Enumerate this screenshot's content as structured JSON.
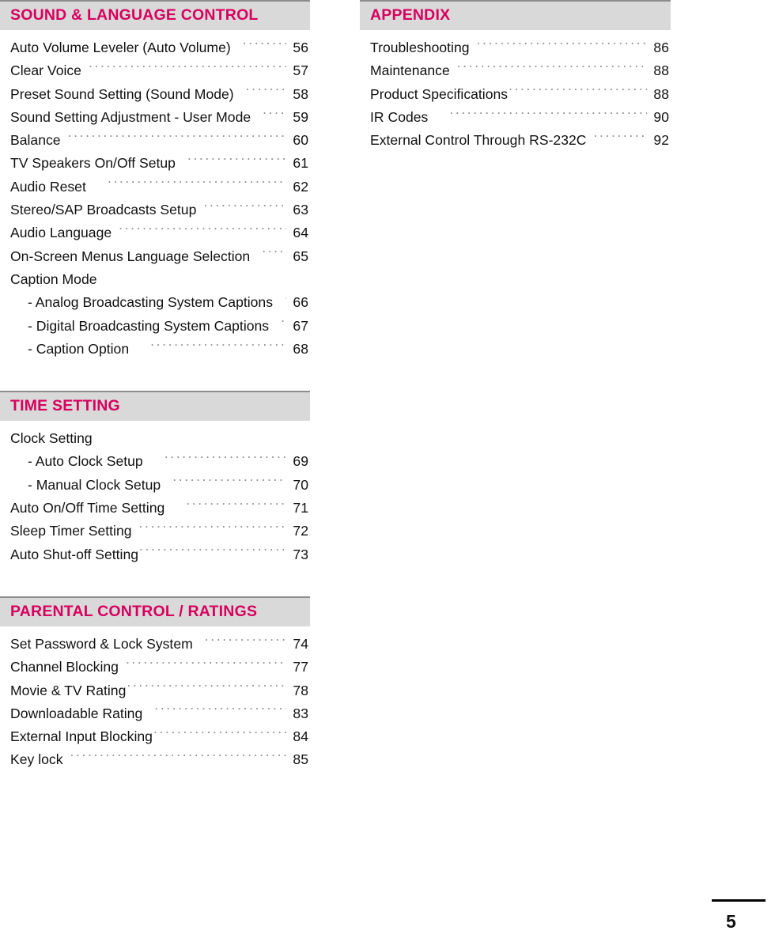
{
  "document": {
    "type": "table-of-contents",
    "page_number": "5"
  },
  "theme": {
    "accent": "#d8005e",
    "header_bar_bg": "#d9d9d9",
    "header_bar_top_rule": "#8d8d8d",
    "text": "#111111",
    "leader_dots": "#8e8e8e",
    "page_bg": "#ffffff"
  },
  "left_column": {
    "sections": [
      {
        "title": "SOUND & LANGUAGE CONTROL",
        "entries": [
          {
            "label": "Auto Volume Leveler (Auto Volume)",
            "page": "56",
            "indent": false,
            "gap": "gap-md"
          },
          {
            "label": "Clear Voice",
            "page": "57",
            "indent": false,
            "gap": "gap-sm"
          },
          {
            "label": "Preset Sound Setting (Sound Mode)",
            "page": "58",
            "indent": false,
            "gap": "gap-md"
          },
          {
            "label": "Sound Setting Adjustment - User Mode",
            "page": "59",
            "indent": false,
            "gap": "gap-md"
          },
          {
            "label": "Balance",
            "page": "60",
            "indent": false,
            "gap": "gap-sm"
          },
          {
            "label": "TV Speakers On/Off Setup",
            "page": "61",
            "indent": false,
            "gap": "gap-md"
          },
          {
            "label": "Audio Reset",
            "page": "62",
            "indent": false,
            "gap": "gap-lg"
          },
          {
            "label": "Stereo/SAP Broadcasts Setup",
            "page": "63",
            "indent": false,
            "gap": "gap-sm"
          },
          {
            "label": "Audio Language",
            "page": "64",
            "indent": false,
            "gap": "gap-sm"
          },
          {
            "label": "On-Screen Menus Language Selection",
            "page": "65",
            "indent": false,
            "gap": "gap-md"
          },
          {
            "label": "Caption Mode",
            "page": "",
            "indent": false,
            "gap": "gap-none",
            "no_leader": true
          },
          {
            "label": "- Analog Broadcasting System Captions",
            "page": "66",
            "indent": true,
            "gap": "gap-md"
          },
          {
            "label": "- Digital Broadcasting System Captions",
            "page": "67",
            "indent": true,
            "gap": "gap-md"
          },
          {
            "label": "- Caption Option",
            "page": "68",
            "indent": true,
            "gap": "gap-lg"
          }
        ]
      },
      {
        "title": "TIME SETTING",
        "entries": [
          {
            "label": "Clock Setting",
            "page": "",
            "indent": false,
            "gap": "gap-none",
            "no_leader": true
          },
          {
            "label": "- Auto Clock Setup",
            "page": "69",
            "indent": true,
            "gap": "gap-lg"
          },
          {
            "label": "- Manual Clock Setup",
            "page": "70",
            "indent": true,
            "gap": "gap-md"
          },
          {
            "label": "Auto On/Off Time Setting",
            "page": "71",
            "indent": false,
            "gap": "gap-lg"
          },
          {
            "label": "Sleep Timer Setting",
            "page": "72",
            "indent": false,
            "gap": "gap-sm"
          },
          {
            "label": "Auto Shut-off Setting",
            "page": "73",
            "indent": false,
            "gap": "gap-none"
          }
        ]
      },
      {
        "title": "PARENTAL CONTROL / RATINGS",
        "entries": [
          {
            "label": "Set Password & Lock System",
            "page": "74",
            "indent": false,
            "gap": "gap-md"
          },
          {
            "label": "Channel Blocking",
            "page": "77",
            "indent": false,
            "gap": "gap-sm"
          },
          {
            "label": "Movie & TV Rating",
            "page": "78",
            "indent": false,
            "gap": "gap-none"
          },
          {
            "label": "Downloadable Rating",
            "page": "83",
            "indent": false,
            "gap": "gap-md"
          },
          {
            "label": "External Input Blocking",
            "page": "84",
            "indent": false,
            "gap": "gap-none"
          },
          {
            "label": "Key lock",
            "page": "85",
            "indent": false,
            "gap": "gap-sm"
          }
        ]
      }
    ]
  },
  "right_column": {
    "sections": [
      {
        "title": "APPENDIX",
        "entries": [
          {
            "label": "Troubleshooting",
            "page": "86",
            "indent": false,
            "gap": "gap-sm"
          },
          {
            "label": "Maintenance",
            "page": "88",
            "indent": false,
            "gap": "gap-sm"
          },
          {
            "label": "Product Specifications",
            "page": "88",
            "indent": false,
            "gap": "gap-none"
          },
          {
            "label": "IR Codes",
            "page": "90",
            "indent": false,
            "gap": "gap-lg"
          },
          {
            "label": "External Control Through RS-232C",
            "page": "92",
            "indent": false,
            "gap": "gap-sm"
          }
        ]
      }
    ]
  }
}
